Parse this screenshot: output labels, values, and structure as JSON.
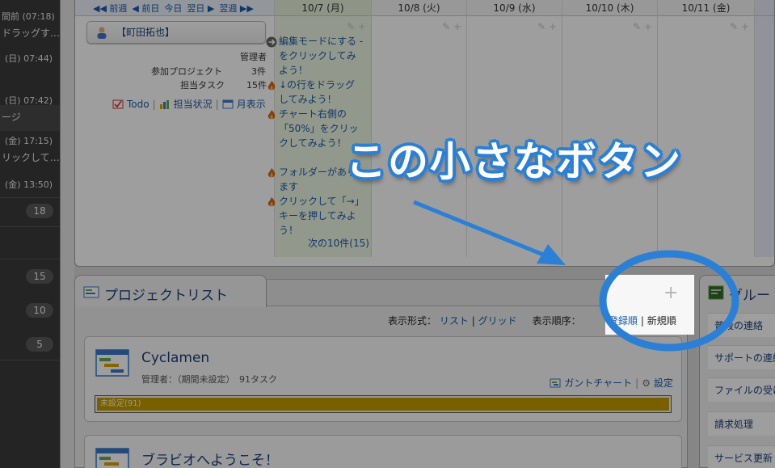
{
  "sidebar": {
    "rows": [
      {
        "text": "間前 (07:18)"
      },
      {
        "text": "ドラッグす…"
      },
      {
        "text": "(日) 07:44)"
      },
      {
        "text": "(日) 07:42)"
      },
      {
        "text": "ージ"
      },
      {
        "text": "(金) 17:15)"
      },
      {
        "text": "リックして…"
      },
      {
        "text": "(金) 13:50)"
      }
    ],
    "badges": [
      "18",
      "15",
      "10",
      "5"
    ]
  },
  "calendar": {
    "nav": {
      "prev_week": "前週",
      "prev_day": "前日",
      "today": "今日",
      "next_day": "翌日",
      "next_week": "翌週"
    },
    "days": [
      "10/7 (月)",
      "10/8 (火)",
      "10/9 (水)",
      "10/10 (木)",
      "10/11 (金)"
    ],
    "user": {
      "name": "【町田拓也】",
      "role": "管理者",
      "projects_label": "参加プロジェクト",
      "projects_count": "3件",
      "tasks_label": "担当タスク",
      "tasks_count": "15件",
      "links": {
        "todo": "Todo",
        "status": "担当状況",
        "monthly": "月表示"
      }
    },
    "tasks": [
      {
        "text": "編集モードにする - をクリックしてみよう！"
      },
      {
        "text": "↓の行をドラッグしてみよう！"
      },
      {
        "text": "チャート右側の「50%」をクリックしてみよう！"
      },
      {
        "text": "フォルダーがあります"
      },
      {
        "text": "クリックして「→」キーを押してみよう！"
      }
    ],
    "more_tasks": "次の10件(15)"
  },
  "project_list": {
    "title": "プロジェクトリスト",
    "plus": "+",
    "view_label": "表示形式：",
    "view_list": "リスト",
    "view_grid": "グリッド",
    "order_label": "表示順序：",
    "order_registered": "登録順",
    "order_new": "新規順",
    "separator": "|",
    "projects": [
      {
        "name": "Cyclamen",
        "meta": "管理者：（期間未設定）　91タスク",
        "gantt": "ガントチャート",
        "settings": "設定",
        "progress_label": "未設定(91)",
        "progress": 1.0
      },
      {
        "name": "ブラビオへようこそ！"
      }
    ]
  },
  "group_panel": {
    "title": "グルー",
    "items": [
      "普段の連絡",
      "サポートの連絡",
      "ファイルの受け",
      "請求処理",
      "サービス更新"
    ]
  },
  "annotation": {
    "text": "この小さなボタン"
  },
  "colors": {
    "accent": "#2b80d6",
    "link": "#1a5aa8",
    "progress": "#c29b00"
  }
}
